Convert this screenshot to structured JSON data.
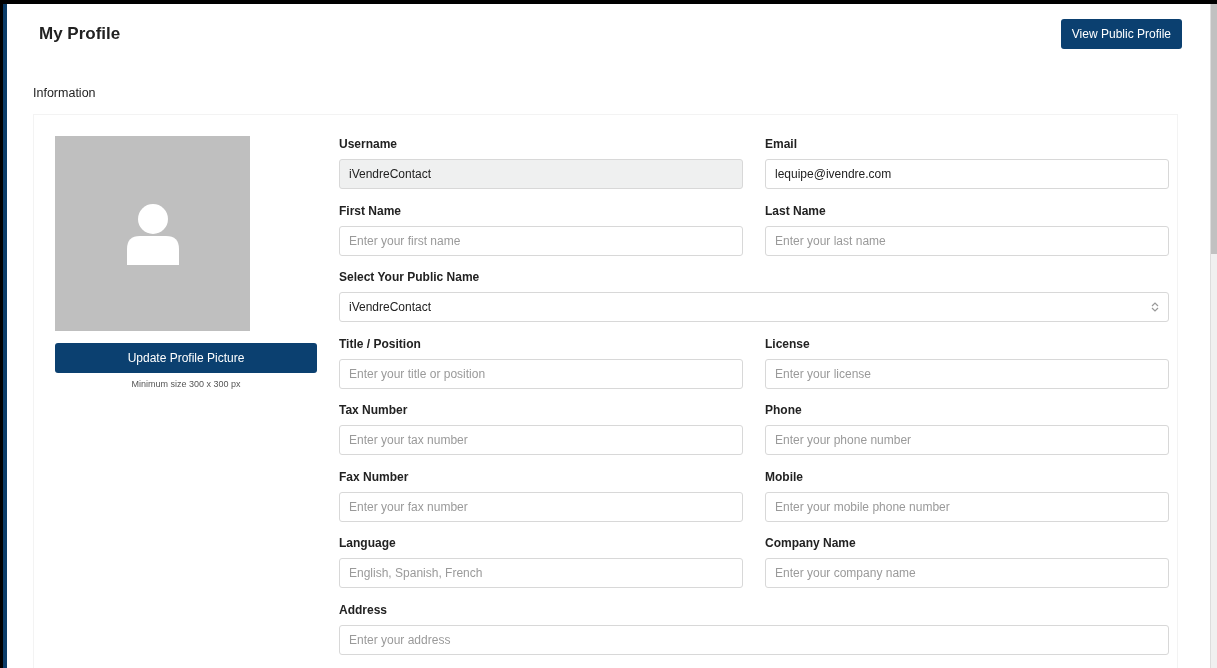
{
  "header": {
    "title": "My Profile",
    "button": "View Public Profile"
  },
  "section_title": "Information",
  "avatar": {
    "button": "Update Profile Picture",
    "hint": "Minimum size 300 x 300 px"
  },
  "fields": [
    {
      "label": "Username",
      "kind": "text",
      "value": "iVendreContact",
      "disabled": true,
      "wide": false
    },
    {
      "label": "Email",
      "kind": "text",
      "value": "lequipe@ivendre.com",
      "disabled": false,
      "wide": false
    },
    {
      "label": "First Name",
      "kind": "text",
      "placeholder": "Enter your first name",
      "disabled": false,
      "wide": false
    },
    {
      "label": "Last Name",
      "kind": "text",
      "placeholder": "Enter your last name",
      "disabled": false,
      "wide": false
    },
    {
      "label": "Select Your Public Name",
      "kind": "select",
      "value": "iVendreContact",
      "disabled": false,
      "wide": true
    },
    {
      "label": "Title / Position",
      "kind": "text",
      "placeholder": "Enter your title or position",
      "disabled": false,
      "wide": false
    },
    {
      "label": "License",
      "kind": "text",
      "placeholder": "Enter your license",
      "disabled": false,
      "wide": false
    },
    {
      "label": "Tax Number",
      "kind": "text",
      "placeholder": "Enter your tax number",
      "disabled": false,
      "wide": false
    },
    {
      "label": "Phone",
      "kind": "text",
      "placeholder": "Enter your phone number",
      "disabled": false,
      "wide": false
    },
    {
      "label": "Fax Number",
      "kind": "text",
      "placeholder": "Enter your fax number",
      "disabled": false,
      "wide": false
    },
    {
      "label": "Mobile",
      "kind": "text",
      "placeholder": "Enter your mobile phone number",
      "disabled": false,
      "wide": false
    },
    {
      "label": "Language",
      "kind": "text",
      "placeholder": "English, Spanish, French",
      "disabled": false,
      "wide": false
    },
    {
      "label": "Company Name",
      "kind": "text",
      "placeholder": "Enter your company name",
      "disabled": false,
      "wide": false
    },
    {
      "label": "Address",
      "kind": "text",
      "placeholder": "Enter your address",
      "disabled": false,
      "wide": true
    }
  ]
}
